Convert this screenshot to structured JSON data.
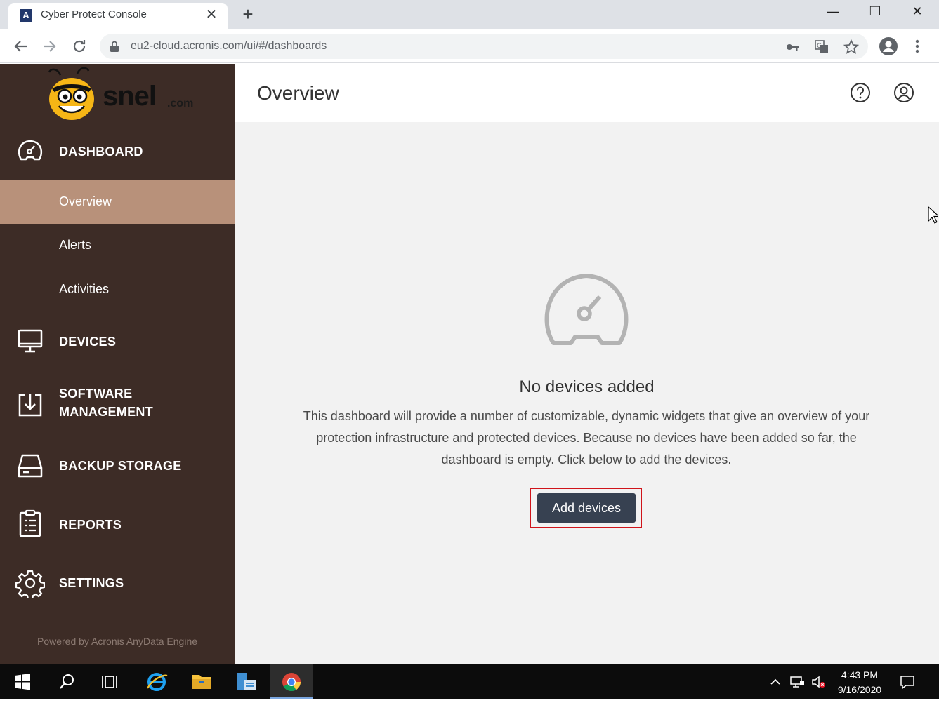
{
  "browser": {
    "tab_favicon": "A",
    "tab_title": "Cyber Protect Console",
    "tab_close": "✕",
    "new_tab": "+",
    "url": "eu2-cloud.acronis.com/ui/#/dashboards",
    "window_min": "—",
    "window_restore": "❐",
    "window_close": "✕"
  },
  "sidebar": {
    "logo_text": "snel",
    "logo_suffix": ".com",
    "sections": {
      "dashboard": "DASHBOARD",
      "devices": "DEVICES",
      "software_line1": "SOFTWARE",
      "software_line2": "MANAGEMENT",
      "backup_storage": "BACKUP STORAGE",
      "reports": "REPORTS",
      "settings": "SETTINGS"
    },
    "dashboard_items": {
      "overview": "Overview",
      "alerts": "Alerts",
      "activities": "Activities"
    },
    "powered_by": "Powered by Acronis AnyData Engine",
    "active_color": "#b8917a",
    "bg_color": "#3d2c26"
  },
  "main": {
    "title": "Overview",
    "empty": {
      "title": "No devices added",
      "description": "This dashboard will provide a number of customizable, dynamic widgets that give an overview of your protection infrastructure and protected devices. Because no devices have been added so far, the dashboard is empty. Click below to add the devices.",
      "button": "Add devices",
      "highlight_color": "#d0141b"
    }
  },
  "taskbar": {
    "time": "4:43 PM",
    "date": "9/16/2020"
  }
}
